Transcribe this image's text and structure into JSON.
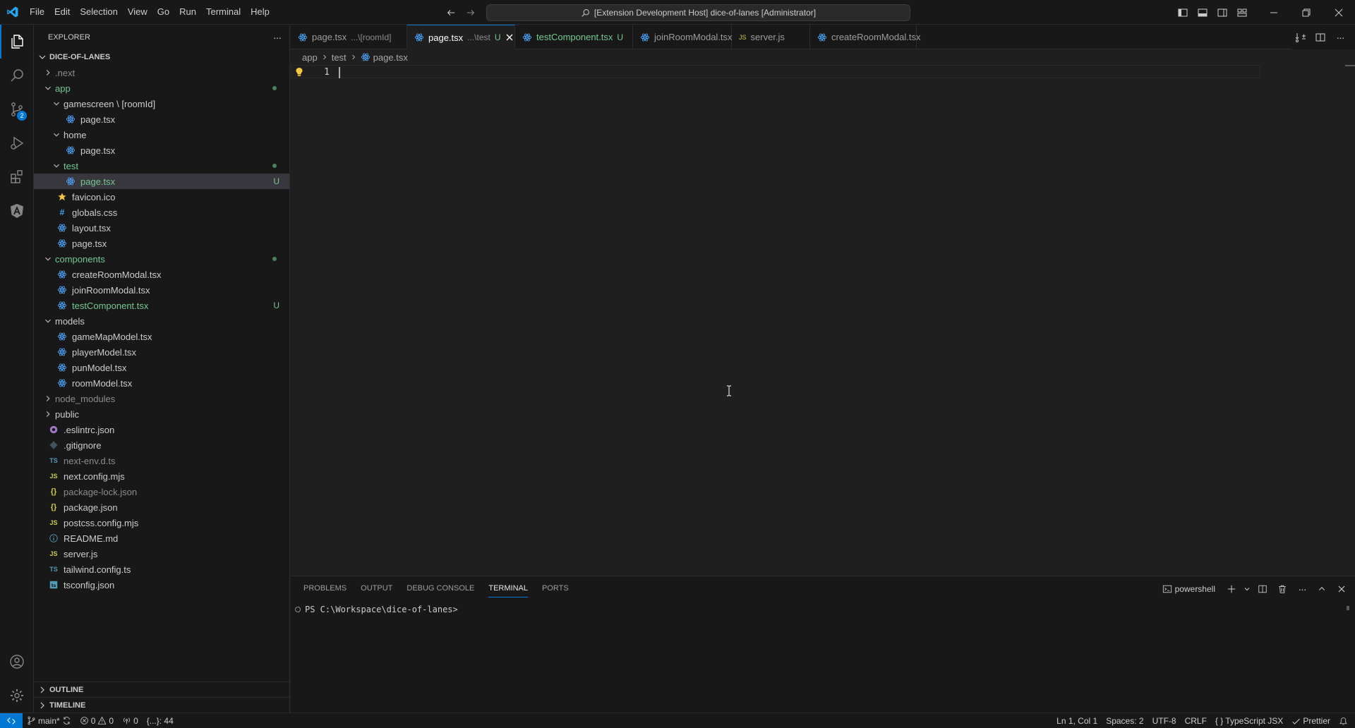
{
  "titlebar": {
    "menu": [
      "File",
      "Edit",
      "Selection",
      "View",
      "Go",
      "Run",
      "Terminal",
      "Help"
    ],
    "search_text": "[Extension Development Host] dice-of-lanes [Administrator]"
  },
  "activitybar": {
    "source_control_badge": "2"
  },
  "explorer": {
    "title": "EXPLORER",
    "more_label": "···",
    "project": "DICE-OF-LANES",
    "outline": "OUTLINE",
    "timeline": "TIMELINE",
    "items": [
      {
        "label": ".next",
        "depth": 0,
        "type": "folder",
        "open": false,
        "style": "ignored"
      },
      {
        "label": "app",
        "depth": 0,
        "type": "folder",
        "open": true,
        "style": "modified",
        "dot": true
      },
      {
        "label": "gamescreen \\ [roomId]",
        "depth": 1,
        "type": "folder",
        "open": true
      },
      {
        "label": "page.tsx",
        "depth": 2,
        "type": "react"
      },
      {
        "label": "home",
        "depth": 1,
        "type": "folder",
        "open": true
      },
      {
        "label": "page.tsx",
        "depth": 2,
        "type": "react"
      },
      {
        "label": "test",
        "depth": 1,
        "type": "folder",
        "open": true,
        "style": "modified",
        "dot": true
      },
      {
        "label": "page.tsx",
        "depth": 2,
        "type": "react",
        "style": "modified",
        "status": "U",
        "selected": true
      },
      {
        "label": "favicon.ico",
        "depth": 1,
        "type": "star"
      },
      {
        "label": "globals.css",
        "depth": 1,
        "type": "css"
      },
      {
        "label": "layout.tsx",
        "depth": 1,
        "type": "react"
      },
      {
        "label": "page.tsx",
        "depth": 1,
        "type": "react"
      },
      {
        "label": "components",
        "depth": 0,
        "type": "folder",
        "open": true,
        "style": "modified",
        "dot": true
      },
      {
        "label": "createRoomModal.tsx",
        "depth": 1,
        "type": "react"
      },
      {
        "label": "joinRoomModal.tsx",
        "depth": 1,
        "type": "react"
      },
      {
        "label": "testComponent.tsx",
        "depth": 1,
        "type": "react",
        "style": "modified",
        "status": "U"
      },
      {
        "label": "models",
        "depth": 0,
        "type": "folder",
        "open": true
      },
      {
        "label": "gameMapModel.tsx",
        "depth": 1,
        "type": "react"
      },
      {
        "label": "playerModel.tsx",
        "depth": 1,
        "type": "react"
      },
      {
        "label": "punModel.tsx",
        "depth": 1,
        "type": "react"
      },
      {
        "label": "roomModel.tsx",
        "depth": 1,
        "type": "react"
      },
      {
        "label": "node_modules",
        "depth": 0,
        "type": "folder",
        "open": false,
        "style": "ignored"
      },
      {
        "label": "public",
        "depth": 0,
        "type": "folder",
        "open": false
      },
      {
        "label": ".eslintrc.json",
        "depth": 0,
        "type": "eslint"
      },
      {
        "label": ".gitignore",
        "depth": 0,
        "type": "git"
      },
      {
        "label": "next-env.d.ts",
        "depth": 0,
        "type": "ts",
        "style": "ignored"
      },
      {
        "label": "next.config.mjs",
        "depth": 0,
        "type": "js"
      },
      {
        "label": "package-lock.json",
        "depth": 0,
        "type": "json",
        "style": "ignored"
      },
      {
        "label": "package.json",
        "depth": 0,
        "type": "json"
      },
      {
        "label": "postcss.config.mjs",
        "depth": 0,
        "type": "js"
      },
      {
        "label": "README.md",
        "depth": 0,
        "type": "info"
      },
      {
        "label": "server.js",
        "depth": 0,
        "type": "js"
      },
      {
        "label": "tailwind.config.ts",
        "depth": 0,
        "type": "ts"
      },
      {
        "label": "tsconfig.json",
        "depth": 0,
        "type": "tsconfig"
      }
    ]
  },
  "tabs": [
    {
      "label": "page.tsx",
      "desc": "...\\[roomId]",
      "icon": "react",
      "active": false
    },
    {
      "label": "page.tsx",
      "desc": "...\\test",
      "mod": "U",
      "icon": "react",
      "active": true
    },
    {
      "label": "testComponent.tsx",
      "mod": "U",
      "icon": "react",
      "active": false,
      "style": "modified"
    },
    {
      "label": "joinRoomModal.tsx",
      "icon": "react",
      "active": false
    },
    {
      "label": "server.js",
      "icon": "js",
      "active": false
    },
    {
      "label": "createRoomModal.tsx",
      "icon": "react",
      "active": false
    }
  ],
  "breadcrumb": {
    "segments": [
      "app",
      "test"
    ],
    "file": "page.tsx"
  },
  "editor": {
    "line_number": "1"
  },
  "panel": {
    "tabs": [
      "PROBLEMS",
      "OUTPUT",
      "DEBUG CONSOLE",
      "TERMINAL",
      "PORTS"
    ],
    "active_tab": 3,
    "terminal_name": "powershell",
    "prompt": "PS C:\\Workspace\\dice-of-lanes>"
  },
  "statusbar": {
    "branch": "main*",
    "errors": "0",
    "warnings": "0",
    "ports": "0",
    "brackets": "{...}: 44",
    "position": "Ln 1, Col 1",
    "spaces": "Spaces: 2",
    "encoding": "UTF-8",
    "eol": "CRLF",
    "language": "TypeScript JSX",
    "formatter": "Prettier"
  },
  "colors": {
    "accent": "#0078d4",
    "untracked": "#73c991",
    "ignored": "#8c8c8c"
  }
}
